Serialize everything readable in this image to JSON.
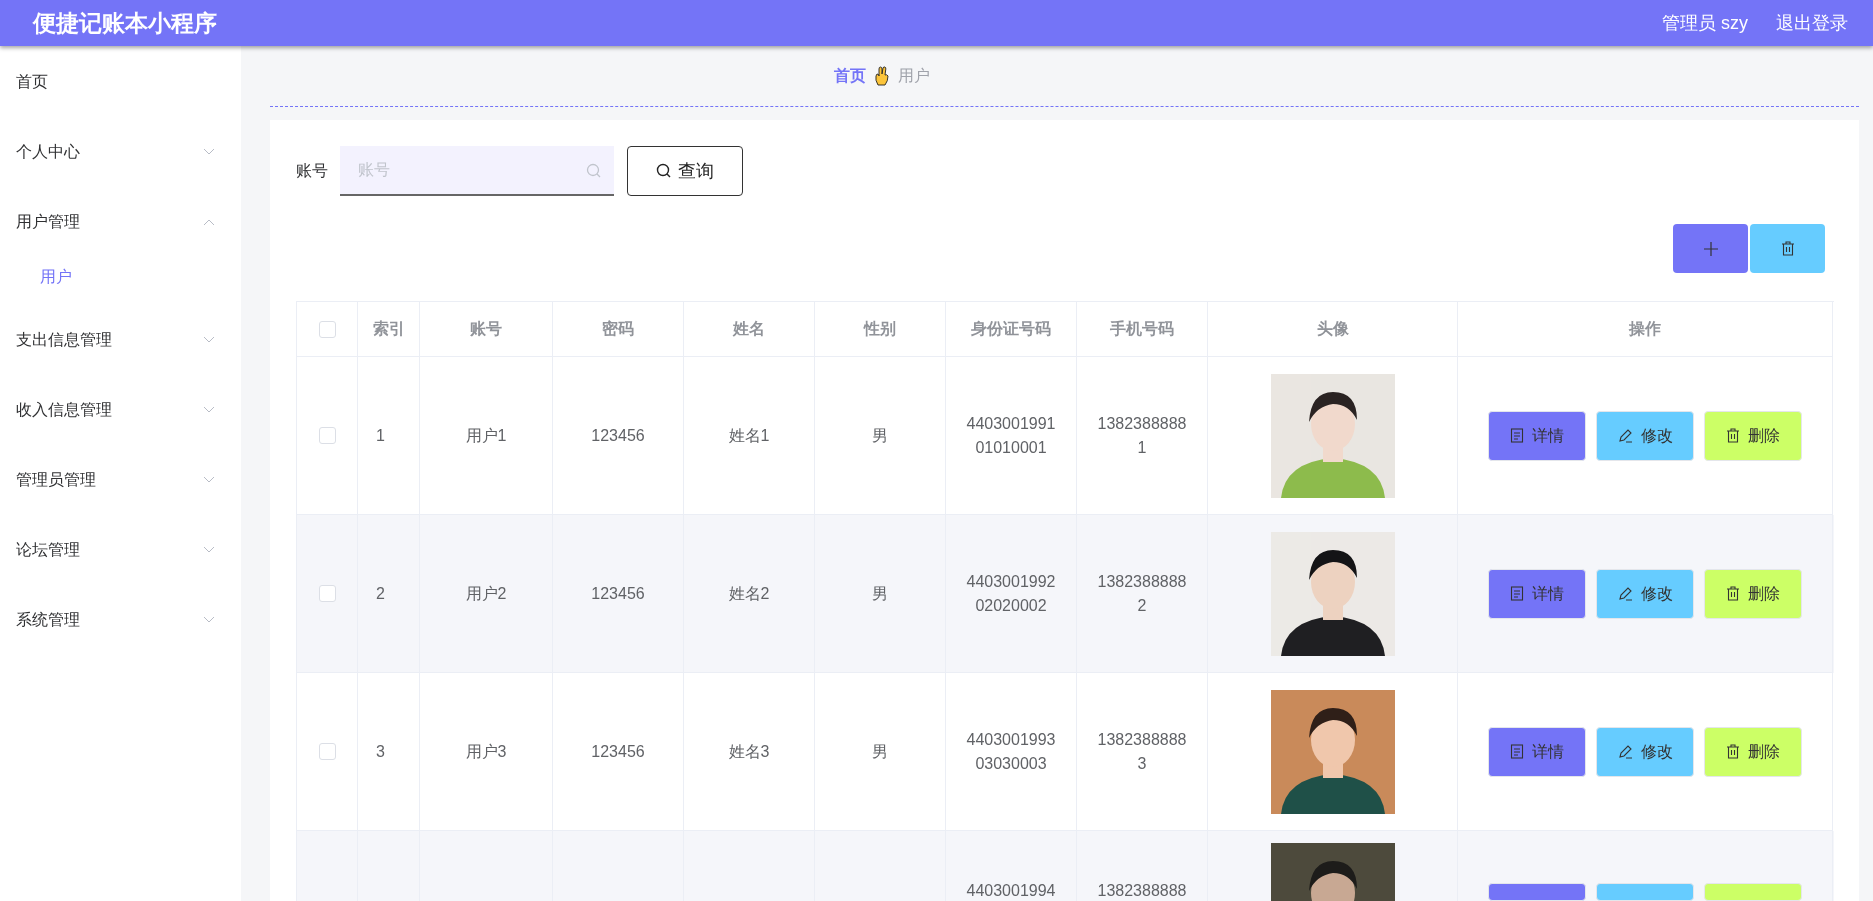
{
  "header": {
    "title": "便捷记账本小程序",
    "user": "管理员 szy",
    "logout": "退出登录"
  },
  "sidebar": {
    "items": [
      {
        "label": "首页",
        "expandable": false
      },
      {
        "label": "个人中心",
        "expandable": true,
        "expanded": false
      },
      {
        "label": "用户管理",
        "expandable": true,
        "expanded": true,
        "children": [
          {
            "label": "用户",
            "selected": true
          }
        ]
      },
      {
        "label": "支出信息管理",
        "expandable": true,
        "expanded": false
      },
      {
        "label": "收入信息管理",
        "expandable": true,
        "expanded": false
      },
      {
        "label": "管理员管理",
        "expandable": true,
        "expanded": false
      },
      {
        "label": "论坛管理",
        "expandable": true,
        "expanded": false
      },
      {
        "label": "系统管理",
        "expandable": true,
        "expanded": false
      }
    ]
  },
  "breadcrumb": [
    {
      "label": "首页",
      "kind": "link"
    },
    {
      "label": "用户",
      "kind": "current"
    }
  ],
  "search": {
    "label": "账号",
    "placeholder": "账号",
    "button": "查询"
  },
  "toolbar": [
    {
      "kind": "add"
    },
    {
      "kind": "delete"
    }
  ],
  "table": {
    "select_all": {
      "checked": false
    },
    "columns": [
      "索引",
      "账号",
      "密码",
      "姓名",
      "性别",
      "身份证号码",
      "手机号码",
      "头像",
      "操作"
    ],
    "rows": [
      {
        "checked": false,
        "cut": false,
        "index": "1",
        "account": "用户1",
        "password": "123456",
        "name": "姓名1",
        "gender": "男",
        "id_card": "440300199101010001",
        "phone": "13823888881",
        "avatar": {
          "kind": "picture"
        },
        "actions": [
          {
            "label": "详情",
            "kind": "detail",
            "color": "#7474f7"
          },
          {
            "label": "修改",
            "kind": "edit",
            "color": "#66ccff"
          },
          {
            "label": "删除",
            "kind": "delete",
            "color": "#ccff66"
          }
        ]
      },
      {
        "checked": false,
        "cut": false,
        "index": "2",
        "account": "用户2",
        "password": "123456",
        "name": "姓名2",
        "gender": "男",
        "id_card": "440300199202020002",
        "phone": "13823888882",
        "avatar": {
          "kind": "picture"
        },
        "actions": [
          {
            "label": "详情",
            "kind": "detail",
            "color": "#7474f7"
          },
          {
            "label": "修改",
            "kind": "edit",
            "color": "#66ccff"
          },
          {
            "label": "删除",
            "kind": "delete",
            "color": "#ccff66"
          }
        ]
      },
      {
        "checked": false,
        "cut": false,
        "index": "3",
        "account": "用户3",
        "password": "123456",
        "name": "姓名3",
        "gender": "男",
        "id_card": "440300199303030003",
        "phone": "13823888883",
        "avatar": {
          "kind": "picture"
        },
        "actions": [
          {
            "label": "详情",
            "kind": "detail",
            "color": "#7474f7"
          },
          {
            "label": "修改",
            "kind": "edit",
            "color": "#66ccff"
          },
          {
            "label": "删除",
            "kind": "delete",
            "color": "#ccff66"
          }
        ]
      },
      {
        "cut": true,
        "id_card": "4403001994",
        "phone": "1382388888",
        "avatar": {
          "kind": "picture"
        },
        "actions": [
          {
            "kind": "detail",
            "color": "#7474f7"
          },
          {
            "kind": "edit",
            "color": "#66ccff"
          },
          {
            "kind": "delete",
            "color": "#ccff66"
          }
        ]
      }
    ]
  }
}
